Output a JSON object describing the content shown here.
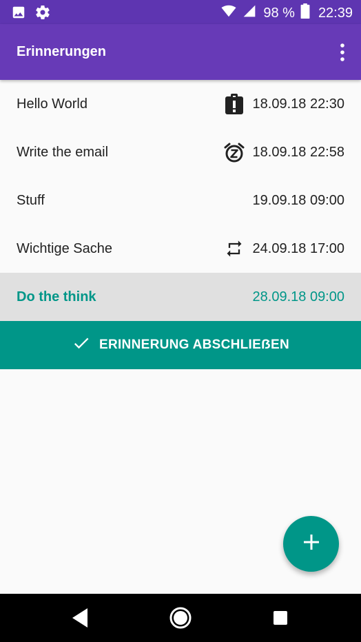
{
  "status_bar": {
    "battery_text": "98 %",
    "time": "22:39",
    "icons": [
      "image-icon",
      "gear-icon",
      "wifi-icon",
      "signal-icon",
      "battery-icon"
    ]
  },
  "app_bar": {
    "title": "Erinnerungen",
    "menu_icon": "more-vert-icon"
  },
  "reminders": [
    {
      "title": "Hello World",
      "date": "18.09.18 22:30",
      "icon": "clipboard-alert-icon"
    },
    {
      "title": "Write the email",
      "date": "18.09.18 22:58",
      "icon": "snooze-alarm-icon"
    },
    {
      "title": "Stuff",
      "date": "19.09.18 09:00",
      "icon": ""
    },
    {
      "title": "Wichtige Sache",
      "date": "24.09.18 17:00",
      "icon": "repeat-icon"
    },
    {
      "title": "Do the think",
      "date": "28.09.18 09:00",
      "icon": "",
      "selected": true
    }
  ],
  "complete_button": {
    "label": "ERINNERUNG ABSCHLIEẞEN",
    "icon": "check-icon"
  },
  "fab": {
    "icon": "plus-icon"
  },
  "nav_bar": {
    "icons": [
      "back-icon",
      "home-icon",
      "recents-icon"
    ]
  },
  "colors": {
    "primary": "#673ab7",
    "primary_dark": "#5e35b1",
    "accent": "#009688",
    "selected_row": "#e0e0e0"
  }
}
